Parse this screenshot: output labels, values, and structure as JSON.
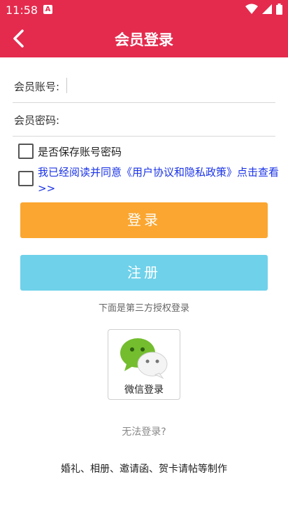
{
  "status_bar": {
    "time": "11:58",
    "app_badge": "A"
  },
  "header": {
    "title": "会员登录"
  },
  "form": {
    "account_label": "会员账号:",
    "account_value": "",
    "password_label": "会员密码:",
    "password_value": ""
  },
  "options": {
    "save_label": "是否保存账号密码",
    "agreement_label": "我已经阅读并同意《用户协议和隐私政策》点击查看>>"
  },
  "buttons": {
    "login": "登录",
    "register": "注册"
  },
  "third_party": {
    "note": "下面是第三方授权登录",
    "wechat_label": "微信登录"
  },
  "links": {
    "cant_login": "无法登录?"
  },
  "footer": {
    "text": "婚礼、相册、邀请函、贺卡请帖等制作"
  },
  "colors": {
    "header": "#e42b4d",
    "login_button": "#fba630",
    "register_button": "#6fd1ea",
    "agreement_link": "#1a33e6"
  },
  "icons": {
    "back": "chevron-left-icon",
    "wifi": "wifi-icon",
    "signal": "cell-signal-icon",
    "battery": "battery-icon",
    "wechat": "wechat-icon"
  }
}
